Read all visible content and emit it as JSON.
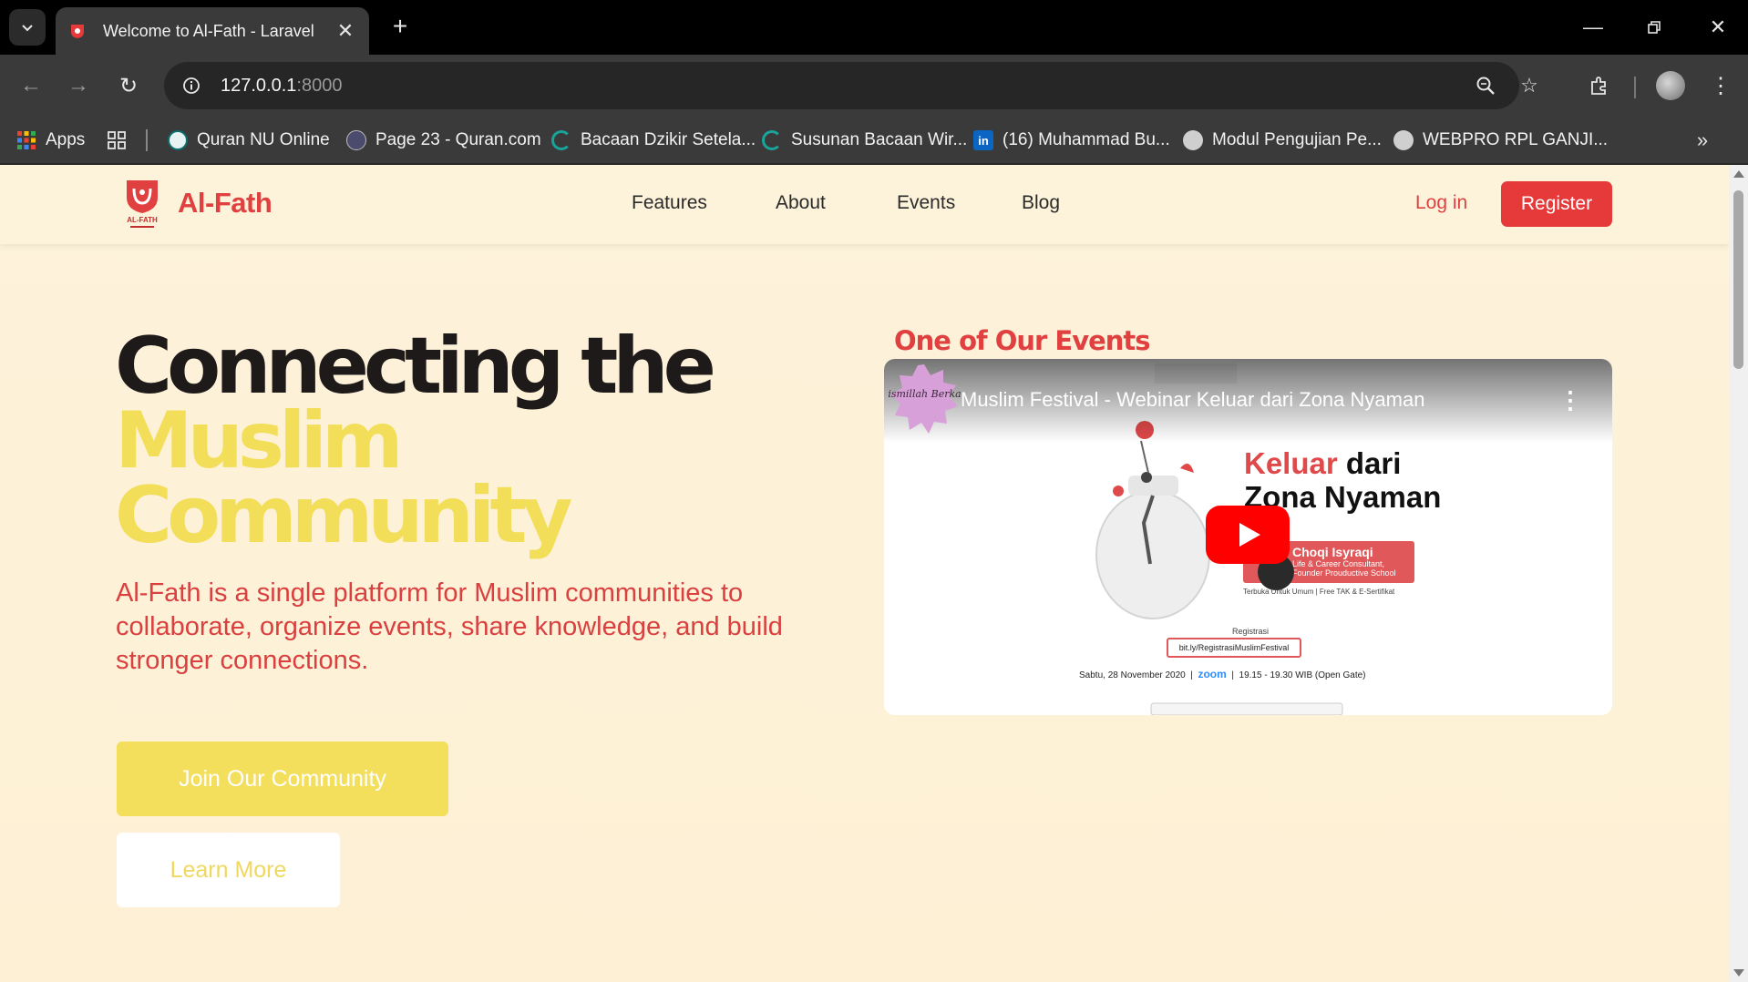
{
  "browser": {
    "tab_title": "Welcome to Al-Fath - Laravel",
    "url_host": "127.0.0.1",
    "url_port": ":8000",
    "bookmarks": [
      {
        "label": "Apps",
        "icon": "apps-grid-icon"
      },
      {
        "label": "Quran NU Online",
        "icon": "quran-nu-icon"
      },
      {
        "label": "Page 23 - Quran.com",
        "icon": "quran-com-icon"
      },
      {
        "label": "Bacaan Dzikir Setela...",
        "icon": "loading-icon"
      },
      {
        "label": "Susunan Bacaan Wir...",
        "icon": "loading-icon"
      },
      {
        "label": "(16) Muhammad Bu...",
        "icon": "linkedin-icon"
      },
      {
        "label": "Modul Pengujian Pe...",
        "icon": "globe-icon"
      },
      {
        "label": "WEBPRO RPL GANJI...",
        "icon": "globe-icon"
      }
    ]
  },
  "site": {
    "brand": "Al-Fath",
    "logo_caption": "AL-FATH",
    "nav": [
      "Features",
      "About",
      "Events",
      "Blog"
    ],
    "login": "Log in",
    "register": "Register"
  },
  "hero": {
    "title_line1": "Connecting the",
    "title_line2": "Muslim",
    "title_line3": "Community",
    "description": "Al-Fath is a single platform for Muslim communities to collaborate, organize events, share knowledge, and build stronger connections.",
    "join_button": "Join Our Community",
    "learn_button": "Learn More"
  },
  "events": {
    "heading": "One of Our Events",
    "video_title": "Muslim Festival - Webinar Keluar dari Zona Nyaman",
    "badge_text": "Bismillah Berkah",
    "thumb_heading_red": "Keluar",
    "thumb_heading_rest": " dari",
    "thumb_heading_line2": "Zona Nyaman",
    "speaker_name": "Choqi Isyraqi",
    "speaker_role": "Life & Career Consultant, Founder Prouductive School",
    "small_note": "Terbuka Untuk Umum | Free TAK & E-Sertifikat",
    "registration_label": "Registrasi",
    "registration_link": "bit.ly/RegistrasiMuslimFestival",
    "date_text": "Sabtu, 28 November 2020",
    "zoom": "zoom",
    "time_text": "19.15 - 19.30 WIB (Open Gate)"
  },
  "colors": {
    "accent_red": "#e5393a",
    "accent_yellow": "#f3de5a",
    "page_bg": "#fdf3da"
  }
}
